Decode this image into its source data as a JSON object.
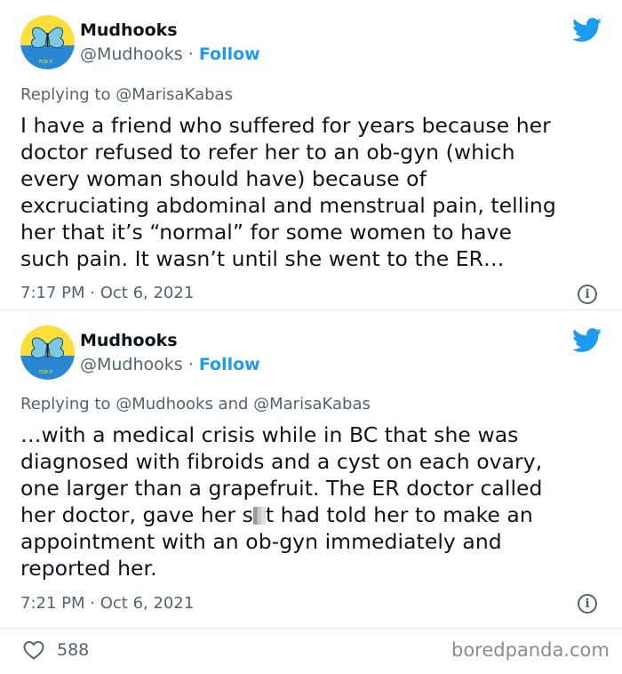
{
  "tweets": [
    {
      "author_name": "Mudhooks",
      "handle": "@Mudhooks",
      "separator": "·",
      "follow_label": "Follow",
      "replying_prefix": "Replying to",
      "replying_to": "@MarisaKabas",
      "lines": [
        "I have a friend who suffered for years because her",
        "doctor refused to refer her to an ob-gyn (which",
        "every woman should have) because of",
        "excruciating abdominal and menstrual pain, telling",
        "her that it’s “normal” for some women to have",
        "such pain. It wasn’t until she went to the ER…"
      ],
      "time": "7:17 PM",
      "date": "Oct 6, 2021"
    },
    {
      "author_name": "Mudhooks",
      "handle": "@Mudhooks",
      "separator": "·",
      "follow_label": "Follow",
      "replying_prefix": "Replying to",
      "replying_to": "@Mudhooks and @MarisaKabas",
      "lines": [
        "…with a medical crisis while in BC that she was",
        "diagnosed with fibroids and a cyst on each ovary,",
        "one larger than a grapefruit. The ER doctor called",
        "appointment with an ob-gyn immediately and",
        "reported her."
      ],
      "line4_before": "her doctor, gave her s",
      "line4_after": "t had told her to make an",
      "time": "7:21 PM",
      "date": "Oct 6, 2021"
    }
  ],
  "likes": "588",
  "watermark": "boredpanda.com",
  "icons": {
    "bird": "twitter-bird-icon",
    "info": "info-icon",
    "heart": "heart-icon"
  },
  "colors": {
    "link_blue": "#1d9bf0",
    "muted": "#536471",
    "text": "#0f1419",
    "avatar_bg": "#fedf3a",
    "avatar_blue": "#2a88d2"
  }
}
